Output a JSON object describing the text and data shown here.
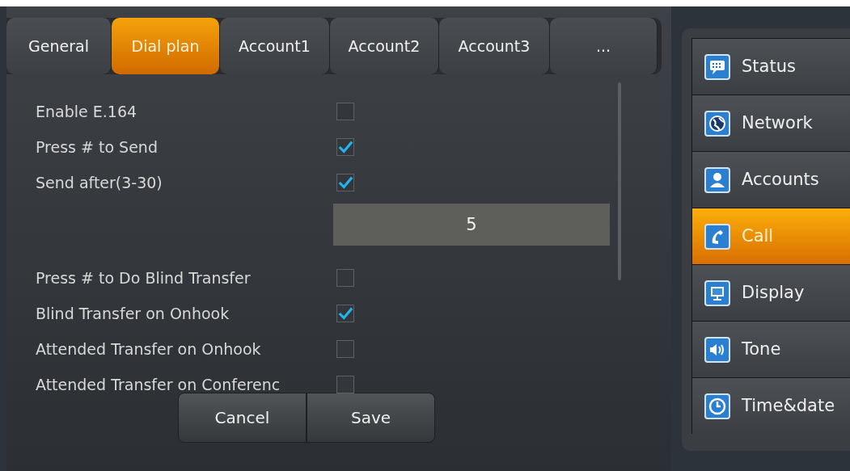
{
  "tabs": [
    {
      "label": "General",
      "selected": false
    },
    {
      "label": "Dial plan",
      "selected": true
    },
    {
      "label": "Account1",
      "selected": false
    },
    {
      "label": "Account2",
      "selected": false
    },
    {
      "label": "Account3",
      "selected": false
    },
    {
      "label": "...",
      "selected": false
    }
  ],
  "settings": [
    {
      "kind": "checkbox",
      "label": "Enable E.164",
      "checked": false
    },
    {
      "kind": "checkbox",
      "label": "Press # to Send",
      "checked": true
    },
    {
      "kind": "checkbox",
      "label": "Send after(3-30)",
      "checked": true
    },
    {
      "kind": "number",
      "value": "5"
    },
    {
      "kind": "checkbox",
      "label": "Press # to Do Blind Transfer",
      "checked": false
    },
    {
      "kind": "checkbox",
      "label": "Blind Transfer on Onhook",
      "checked": true
    },
    {
      "kind": "checkbox",
      "label": "Attended Transfer on Onhook",
      "checked": false
    },
    {
      "kind": "checkbox",
      "label": "Attended Transfer on Conferenc",
      "checked": false
    }
  ],
  "buttons": [
    "Cancel",
    "Save"
  ],
  "menu": [
    {
      "label": "Status",
      "selected": false
    },
    {
      "label": "Network",
      "selected": false
    },
    {
      "label": "Accounts",
      "selected": false
    },
    {
      "label": "Call",
      "selected": true
    },
    {
      "label": "Display",
      "selected": false
    },
    {
      "label": "Tone",
      "selected": false
    },
    {
      "label": "Time&date",
      "selected": false
    }
  ]
}
